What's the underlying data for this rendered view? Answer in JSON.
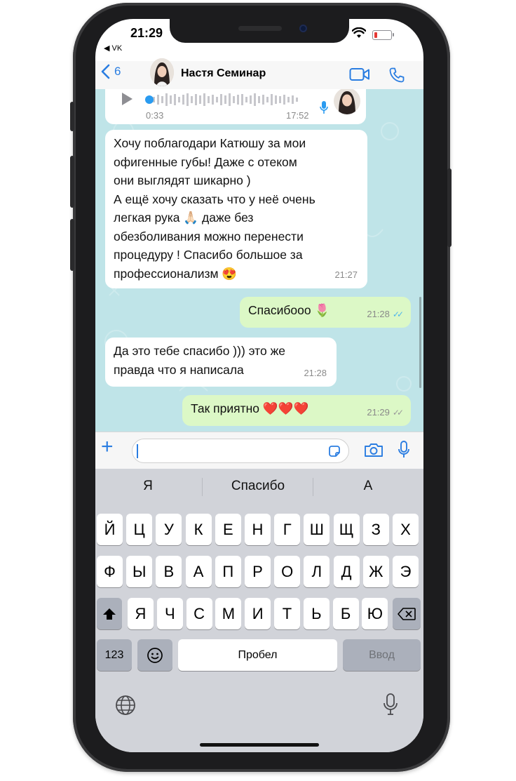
{
  "status": {
    "time": "21:29",
    "back_app": "◀ VK"
  },
  "header": {
    "back_count": "6",
    "contact_name": "Настя Семинар"
  },
  "voice": {
    "duration": "0:33",
    "time": "17:52"
  },
  "messages": [
    {
      "dir": "in",
      "text": "Хочу поблагодари Катюшу за мои офигенные губы! Даже с отеком они выглядят шикарно )",
      "time": "21:27"
    },
    {
      "dir": "out",
      "text": "Спасибооо 🌷",
      "time": "21:28"
    },
    {
      "dir": "in",
      "text": "Да это тебе спасибо ))) это же правда что я написала",
      "time": "21:28"
    },
    {
      "dir": "out",
      "text": "Так приятно ❤️❤️❤️",
      "time": "21:29"
    }
  ],
  "msg1_lines": [
    "Хочу поблагодари Катюшу за мои",
    "офигенные губы! Даже с отеком",
    "они выглядят шикарно )",
    "А ещё хочу сказать что у неё очень",
    "легкая рука 🙏🏻 даже без",
    "обезболивания можно перенести",
    "процедуру ! Спасибо большое за",
    "профессионализм 😍"
  ],
  "msg3_lines": [
    "Да это тебе спасибо ))) это же",
    "правда что я написала"
  ],
  "suggestions": [
    "Я",
    "Спасибо",
    "А"
  ],
  "keyboard": {
    "row1": [
      "Й",
      "Ц",
      "У",
      "К",
      "Е",
      "Н",
      "Г",
      "Ш",
      "Щ",
      "З",
      "Х"
    ],
    "row2": [
      "Ф",
      "Ы",
      "В",
      "А",
      "П",
      "Р",
      "О",
      "Л",
      "Д",
      "Ж",
      "Э"
    ],
    "row3": [
      "Я",
      "Ч",
      "С",
      "М",
      "И",
      "Т",
      "Ь",
      "Б",
      "Ю"
    ],
    "numbers": "123",
    "space": "Пробел",
    "enter": "Ввод"
  },
  "colors": {
    "accent": "#2a7de1",
    "chat_bg": "#bfe4e8",
    "outgoing": "#dcf8c6",
    "read_ticks": "#4fb6ec"
  },
  "icons": [
    "wifi-icon",
    "battery-icon",
    "back-chevron-icon",
    "video-call-icon",
    "phone-icon",
    "play-icon",
    "mic-icon",
    "plus-icon",
    "sticker-icon",
    "camera-icon",
    "shift-icon",
    "backspace-icon",
    "emoji-icon",
    "globe-icon",
    "dictation-icon"
  ]
}
